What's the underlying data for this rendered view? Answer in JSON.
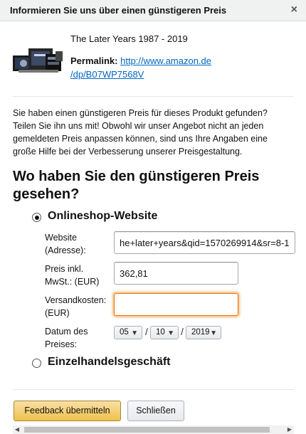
{
  "header": {
    "title": "Informieren Sie uns über einen günstigeren Preis",
    "close_glyph": "×"
  },
  "product": {
    "title": "The Later Years 1987 - 2019",
    "permalink_label": "Permalink:",
    "permalink_line1": "http://www.amazon.de",
    "permalink_line2": "/dp/B07WP7568V"
  },
  "description": {
    "lines": [
      "Sie haben einen günstigeren Preis für dieses Produkt gefunden?",
      "Teilen Sie ihn uns mit! Obwohl wir unser Angebot nicht an jeden",
      "gemeldeten Preis anpassen können, sind uns Ihre Angaben eine",
      "große Hilfe bei der Verbesserung unserer Preisgestaltung."
    ]
  },
  "question": {
    "line1": "Wo haben Sie den günstigeren Preis",
    "line2": "gesehen?"
  },
  "options": {
    "online": "Onlineshop-Website",
    "retail": "Einzelhandelsgeschäft",
    "selected": "online"
  },
  "form": {
    "website": {
      "label1": "Website",
      "label2": "(Adresse):",
      "value": "he+later+years&qid=1570269914&sr=8-1"
    },
    "price": {
      "label1": "Preis inkl.",
      "label2": "MwSt.: (EUR)",
      "value": "362,81"
    },
    "shipping": {
      "label1": "Versandkosten:",
      "label2": "(EUR)",
      "value": ""
    },
    "date": {
      "label1": "Datum des",
      "label2": "Preises:",
      "day": "05",
      "month": "10",
      "year": "2019",
      "separator": "/"
    }
  },
  "buttons": {
    "submit": "Feedback übermitteln",
    "close": "Schließen"
  },
  "colors": {
    "link": "#0066c0",
    "primary_button": "#f0c14b",
    "focus": "#e77600"
  },
  "icons": {
    "close": "close-icon",
    "select_arrow": "chevron-down-icon",
    "scroll_left": "arrow-left-icon",
    "scroll_right": "arrow-right-icon"
  }
}
